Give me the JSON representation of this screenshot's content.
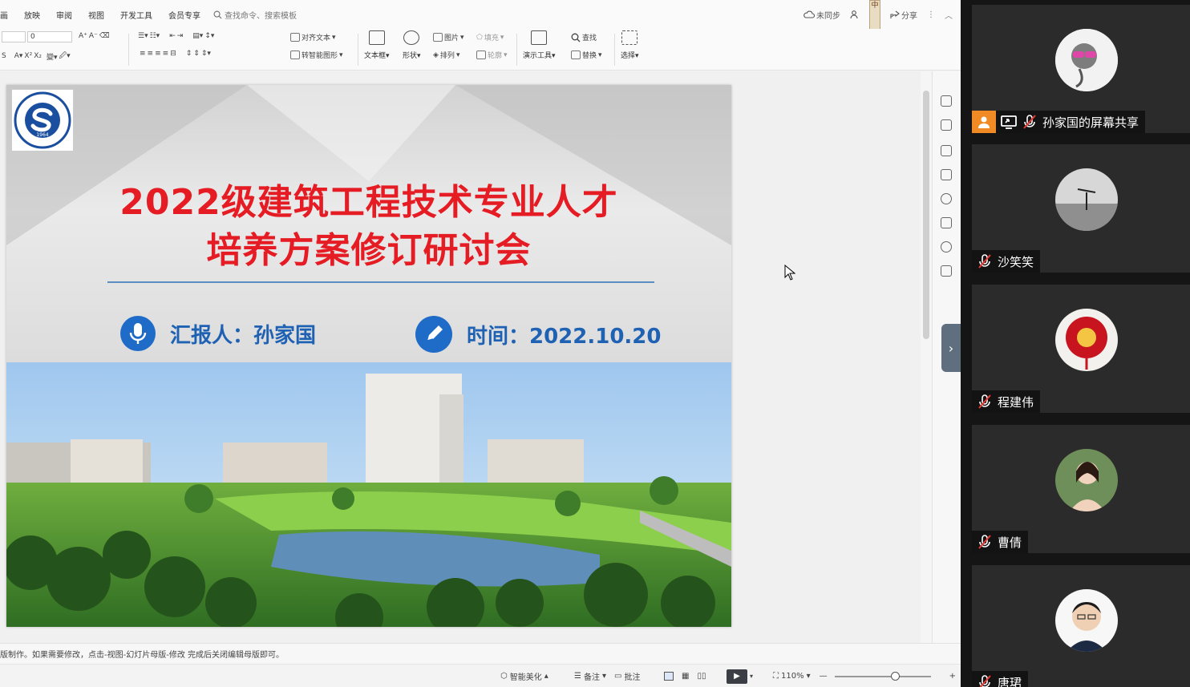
{
  "menu": {
    "items": [
      "画",
      "放映",
      "审阅",
      "视图",
      "开发工具",
      "会员专享"
    ],
    "search_placeholder": "查找命令、搜索模板",
    "sync_status": "未同步",
    "share": "分享",
    "vertical_tag": "中"
  },
  "ribbon": {
    "font_size_value": "0",
    "align_text": "对齐文本",
    "smart_art": "转智能图形",
    "textbox": "文本框",
    "shape": "形状",
    "picture": "图片",
    "arrange": "排列",
    "fill": "填充",
    "outline": "轮廓",
    "presentation_tools": "演示工具",
    "find": "查找",
    "replace": "替换",
    "select": "选择"
  },
  "slide": {
    "title_line1": "2022级建筑工程技术专业人才",
    "title_line2": "培养方案修订研讨会",
    "reporter": "汇报人：孙家国",
    "date": "时间：2022.10.20",
    "logo_year": "1964"
  },
  "notes_text": "版制作。如果需要修改，点击-视图-幻灯片母版-修改 完成后关闭编辑母版即可。",
  "status": {
    "beautify": "智能美化",
    "notes": "备注",
    "comments": "批注",
    "zoom": "110%"
  },
  "participants": [
    {
      "name": "孙家国的屏幕共享"
    },
    {
      "name": "沙笑笑"
    },
    {
      "name": "程建伟"
    },
    {
      "name": "曹倩"
    },
    {
      "name": "唐珺"
    }
  ],
  "colors": {
    "title_red": "#e51c23",
    "accent_blue": "#1f62b3",
    "presenter_orange": "#f08a24"
  }
}
